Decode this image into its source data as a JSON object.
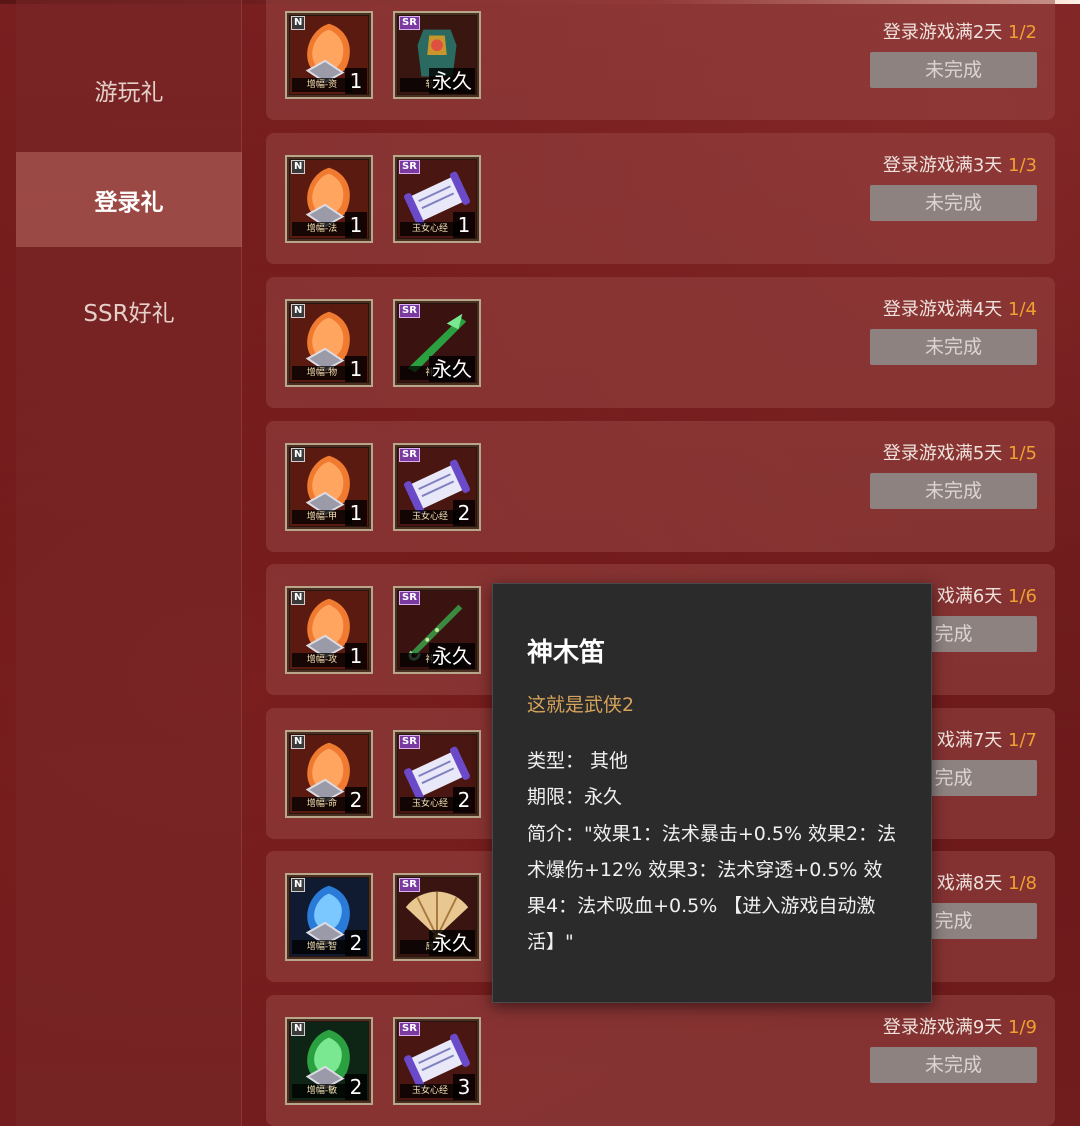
{
  "sidebar": {
    "items": [
      {
        "label": "游玩礼"
      },
      {
        "label": "登录礼",
        "active": true
      },
      {
        "label": "SSR好礼"
      }
    ]
  },
  "rows": [
    {
      "condition": "登录游戏满2天 ",
      "progress": "1/2",
      "button": "未完成",
      "items": [
        {
          "rarity": "N",
          "name": "增幅-资",
          "count": "1",
          "art": "orange-token"
        },
        {
          "rarity": "SR",
          "name": "软",
          "count": "永久",
          "art": "armor"
        }
      ]
    },
    {
      "condition": "登录游戏满3天 ",
      "progress": "1/3",
      "button": "未完成",
      "items": [
        {
          "rarity": "N",
          "name": "增幅-法",
          "count": "1",
          "art": "orange-token"
        },
        {
          "rarity": "SR",
          "name": "玉女心经",
          "count": "1",
          "art": "scroll"
        }
      ]
    },
    {
      "condition": "登录游戏满4天 ",
      "progress": "1/4",
      "button": "未完成",
      "items": [
        {
          "rarity": "N",
          "name": "增幅-物",
          "count": "1",
          "art": "orange-token"
        },
        {
          "rarity": "SR",
          "name": "神",
          "count": "永久",
          "art": "green-weapon"
        }
      ]
    },
    {
      "condition": "登录游戏满5天 ",
      "progress": "1/5",
      "button": "未完成",
      "items": [
        {
          "rarity": "N",
          "name": "增幅-甲",
          "count": "1",
          "art": "orange-token"
        },
        {
          "rarity": "SR",
          "name": "玉女心经",
          "count": "2",
          "art": "scroll"
        }
      ]
    },
    {
      "condition": "戏满6天 ",
      "progress": "1/6",
      "button": "完成",
      "items": [
        {
          "rarity": "N",
          "name": "增幅-攻",
          "count": "1",
          "art": "orange-token"
        },
        {
          "rarity": "SR",
          "name": "神",
          "count": "永久",
          "art": "flute"
        }
      ]
    },
    {
      "condition": "戏满7天 ",
      "progress": "1/7",
      "button": "完成",
      "items": [
        {
          "rarity": "N",
          "name": "增幅-命",
          "count": "2",
          "art": "orange-token"
        },
        {
          "rarity": "SR",
          "name": "玉女心经",
          "count": "2",
          "art": "scroll"
        }
      ]
    },
    {
      "condition": "戏满8天 ",
      "progress": "1/8",
      "button": "完成",
      "items": [
        {
          "rarity": "N",
          "name": "增幅-智",
          "count": "2",
          "art": "blue-token"
        },
        {
          "rarity": "SR",
          "name": "扇",
          "count": "永久",
          "art": "fan"
        }
      ]
    },
    {
      "condition": "登录游戏满9天 ",
      "progress": "1/9",
      "button": "未完成",
      "items": [
        {
          "rarity": "N",
          "name": "增幅-敏",
          "count": "2",
          "art": "green-token"
        },
        {
          "rarity": "SR",
          "name": "玉女心经",
          "count": "3",
          "art": "scroll"
        }
      ]
    }
  ],
  "tooltip": {
    "title": "神木笛",
    "subtitle": "这就是武侠2",
    "type_line": "类型： 其他",
    "period_line": "期限：永久",
    "desc": "简介：\"效果1：法术暴击+0.5% 效果2：法术爆伤+12% 效果3：法术穿透+0.5% 效果4：法术吸血+0.5% 【进入游戏自动激活】\""
  },
  "colors": {
    "background": "#6b1a1b",
    "row": "#96463f",
    "progress_accent": "#f0a030",
    "button_disabled": "#8d8280",
    "tooltip_bg": "#2b2b2b",
    "tooltip_subtitle": "#d6a35a"
  }
}
